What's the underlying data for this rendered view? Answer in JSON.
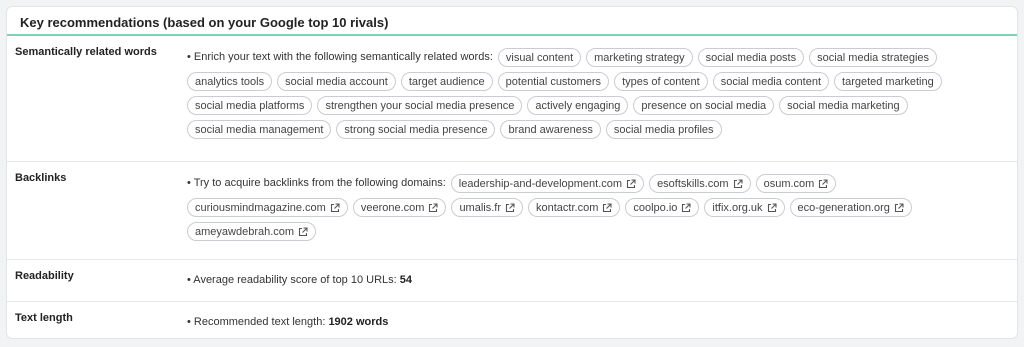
{
  "header": {
    "title": "Key recommendations (based on your Google top 10 rivals)"
  },
  "semantic": {
    "label": "Semantically related words",
    "lead": "• Enrich your text with the following semantically related words:",
    "words": [
      "visual content",
      "marketing strategy",
      "social media posts",
      "social media strategies",
      "analytics tools",
      "social media account",
      "target audience",
      "potential customers",
      "types of content",
      "social media content",
      "targeted marketing",
      "social media platforms",
      "strengthen your social media presence",
      "actively engaging",
      "presence on social media",
      "social media marketing",
      "social media management",
      "strong social media presence",
      "brand awareness",
      "social media profiles"
    ]
  },
  "backlinks": {
    "label": "Backlinks",
    "lead": "• Try to acquire backlinks from the following domains:",
    "domains": [
      "leadership-and-development.com",
      "esoftskills.com",
      "osum.com",
      "curiousmindmagazine.com",
      "veerone.com",
      "umalis.fr",
      "kontactr.com",
      "coolpo.io",
      "itfix.org.uk",
      "eco-generation.org",
      "ameyawdebrah.com"
    ],
    "icon": "external-link-icon"
  },
  "readability": {
    "label": "Readability",
    "lead": "• Average readability score of top 10 URLs:",
    "value": "54"
  },
  "text_length": {
    "label": "Text length",
    "lead": "• Recommended text length:",
    "value": "1902 words"
  },
  "colors": {
    "accent": "#7fd3b1",
    "chip_border": "#c9ccd1"
  }
}
